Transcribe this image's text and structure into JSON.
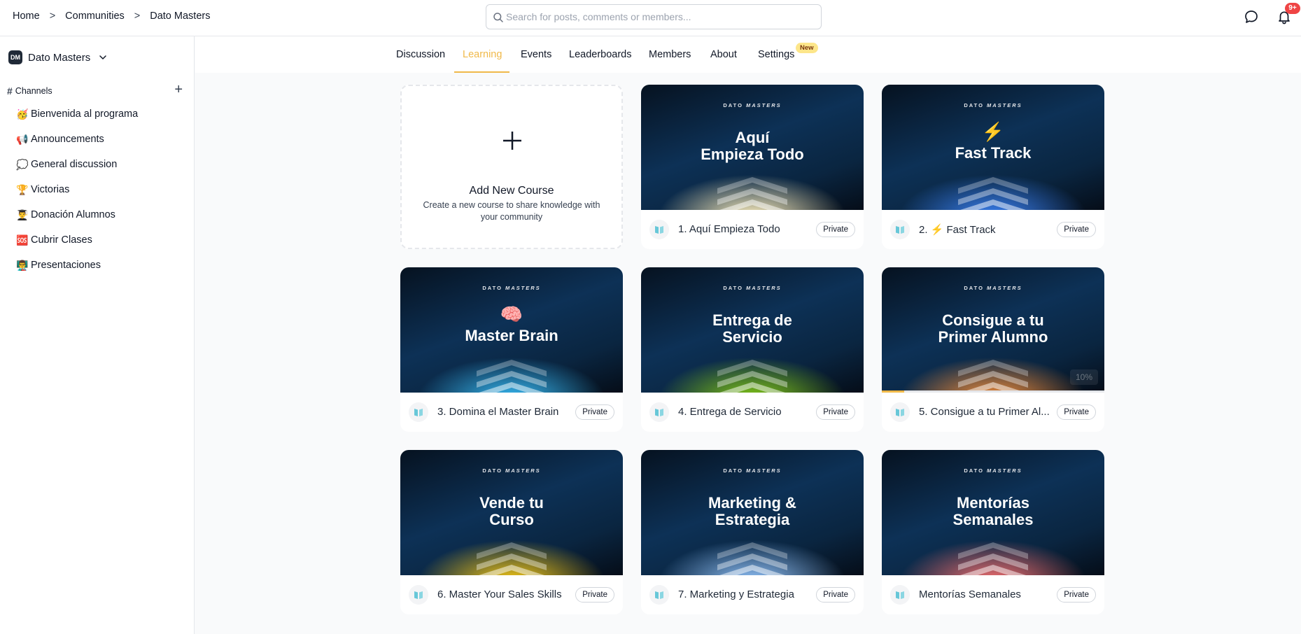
{
  "header": {
    "breadcrumb": [
      "Home",
      "Communities",
      "Dato Masters"
    ],
    "separator": ">",
    "search_placeholder": "Search for posts, comments or members...",
    "notification_count": "9+",
    "icons": [
      "search-icon",
      "chat-icon",
      "bell-icon"
    ]
  },
  "sidebar": {
    "community_logo": "DM",
    "community_name": "Dato Masters",
    "channels_label": "Channels",
    "channels": [
      {
        "emoji": "🥳",
        "label": "Bienvenida al programa"
      },
      {
        "emoji": "📢",
        "label": "Announcements"
      },
      {
        "emoji": "💭",
        "label": "General discussion"
      },
      {
        "emoji": "🏆",
        "label": "Victorias"
      },
      {
        "emoji": "👨‍🎓",
        "label": "Donación Alumnos"
      },
      {
        "emoji": "🆘",
        "label": "Cubrir Clases"
      },
      {
        "emoji": "👨‍🏫",
        "label": "Presentaciones"
      }
    ]
  },
  "tabs": {
    "items": [
      "Discussion",
      "Learning",
      "Events",
      "Leaderboards",
      "Members",
      "About",
      "Settings"
    ],
    "active": "Learning",
    "new_badge": "New"
  },
  "add_course": {
    "title": "Add New Course",
    "description": "Create a new course to share knowledge with your community"
  },
  "brand_mark": {
    "prefix": "DATO",
    "suffix": "MASTERS"
  },
  "courses": [
    {
      "cover_lines": [
        "Aquí",
        "Empieza Todo"
      ],
      "cover_emoji": "",
      "name": "1. Aquí Empieza Todo",
      "badge": "Private",
      "glow": "#fff1c0"
    },
    {
      "cover_lines": [
        "Fast Track"
      ],
      "cover_emoji": "⚡",
      "name": "2. ⚡ Fast Track",
      "badge": "Private",
      "glow": "#3b82f6"
    },
    {
      "cover_lines": [
        "Master Brain"
      ],
      "cover_emoji": "🧠",
      "name": "3. Domina el Master Brain",
      "badge": "Private",
      "glow": "#38bdf8"
    },
    {
      "cover_lines": [
        "Entrega de",
        "Servicio"
      ],
      "cover_emoji": "",
      "name": "4. Entrega de Servicio",
      "badge": "Private",
      "glow": "#84cc16"
    },
    {
      "cover_lines": [
        "Consigue a tu",
        "Primer Alumno"
      ],
      "cover_emoji": "",
      "name": "5. Consigue a tu Primer Al...",
      "badge": "Private",
      "glow": "#fb923c",
      "progress": 0.1,
      "progress_label": "10%"
    },
    {
      "cover_lines": [
        "Vende tu",
        "Curso"
      ],
      "cover_emoji": "",
      "name": "6. Master Your Sales Skills",
      "badge": "Private",
      "glow": "#facc15"
    },
    {
      "cover_lines": [
        "Marketing &",
        "Estrategia"
      ],
      "cover_emoji": "",
      "name": "7. Marketing y Estrategia",
      "badge": "Private",
      "glow": "#93c5fd"
    },
    {
      "cover_lines": [
        "Mentorías",
        "Semanales"
      ],
      "cover_emoji": "",
      "name": "Mentorías Semanales",
      "badge": "Private",
      "glow": "#f87171"
    }
  ]
}
